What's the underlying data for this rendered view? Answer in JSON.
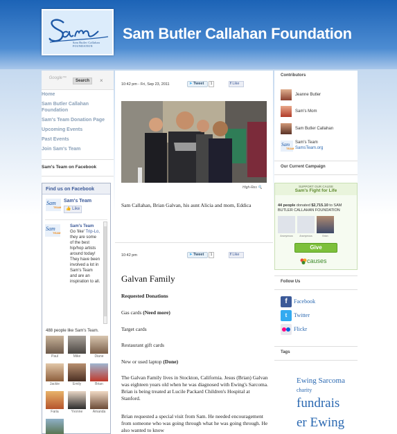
{
  "header": {
    "logo_script": "Sam",
    "logo_sub": "Sam Butler Callahan",
    "logo_sub2": "FOUNDATION",
    "title": "Sam Butler Callahan Foundation"
  },
  "search": {
    "placeholder": "Google™",
    "button": "Search",
    "clear": "×"
  },
  "nav": [
    "Home",
    "Sam Butler Callahan Foundation",
    "Sam's Team Donation Page",
    "Upcoming Events",
    "Past Events",
    "Join Sam's Team"
  ],
  "facebook": {
    "section_title": "Sam's Team on Facebook",
    "box_title": "Find us on Facebook",
    "page_name": "Sam's Team",
    "like_label": "Like",
    "post_author": "Sam's Team",
    "post_text_1": "Go 'like'",
    "post_link": "Trip-Lo,",
    "post_text_2": "they are some of the best hip/hop artists around today! They have been involved a lot in Sam's Team and are an inspiration to all.",
    "count_text": "488 people like Sam's Team.",
    "fans": [
      "Paul",
      "Mike",
      "Diane",
      "Jackie",
      "Emily",
      "Brian",
      "Faria",
      "Yvonne",
      "Amanda"
    ]
  },
  "posts": [
    {
      "time": "10:42 pm - Fri, Sep 23, 2011",
      "tweet_label": "Tweet",
      "tweet_count": "1",
      "like_label": "Like",
      "hires": "High-Res",
      "caption": "Sam Callahan, Brian Galvan, his aunt Alicia and mom, Eddica"
    },
    {
      "time": "10:42 pm",
      "tweet_label": "Tweet",
      "tweet_count": "1",
      "like_label": "Like",
      "title": "Galvan Family",
      "requested": "Requested Donations",
      "items": [
        {
          "text": "Gas cards ",
          "note": "(Need more)"
        },
        {
          "text": "Target cards",
          "note": ""
        },
        {
          "text": "Restaurant gift cards",
          "note": ""
        },
        {
          "text": "New or used laptop ",
          "note": "(Done)"
        }
      ],
      "para1": "The Galvan Family lives in Stockton, California. Jesus (Brian) Galvan was eighteen years old when he was diagnosed with Ewing's Sarcoma. Brian is being treated at Lucile Packard Children's Hospital at Stanford.",
      "para2": "Brian requested a special visit from Sam. He needed encouragement from someone who was going through what he was going through. He also wanted to know"
    }
  ],
  "contributors": {
    "title": "Contributors",
    "items": [
      {
        "name": "Jeanne Butler"
      },
      {
        "name": "Sam's Mom"
      },
      {
        "name": "Sam Butler Callahan"
      },
      {
        "name": "Sam's Team",
        "link": "SamsTeam.org"
      }
    ]
  },
  "campaign": {
    "title": "Our Current Campaign",
    "kicker": "SUPPORT OUR CAUSE",
    "name": "Sam's Fight for Life",
    "donated_count": "44 people",
    "donated_text": " donated ",
    "amount": "$2,715.10",
    "donated_suffix": " to SAM BUTLER CALLAHAN FOUNDATION",
    "donors": [
      "Anonymous",
      "Anonymous",
      "Brian"
    ],
    "give_label": "Give",
    "causes_label": "causes"
  },
  "follow": {
    "title": "Follow Us",
    "items": [
      {
        "label": "Facebook",
        "icon": "facebook-icon",
        "color": "#3b5998"
      },
      {
        "label": "Twitter",
        "icon": "twitter-icon",
        "color": "#33aaf0"
      },
      {
        "label": "Flickr",
        "icon": "flickr-icon",
        "color": "#e8e8ee"
      }
    ]
  },
  "tags": {
    "title": "Tags",
    "items": [
      "Ewing Sarcoma",
      "charity",
      "fundrais",
      "er Ewing"
    ]
  }
}
